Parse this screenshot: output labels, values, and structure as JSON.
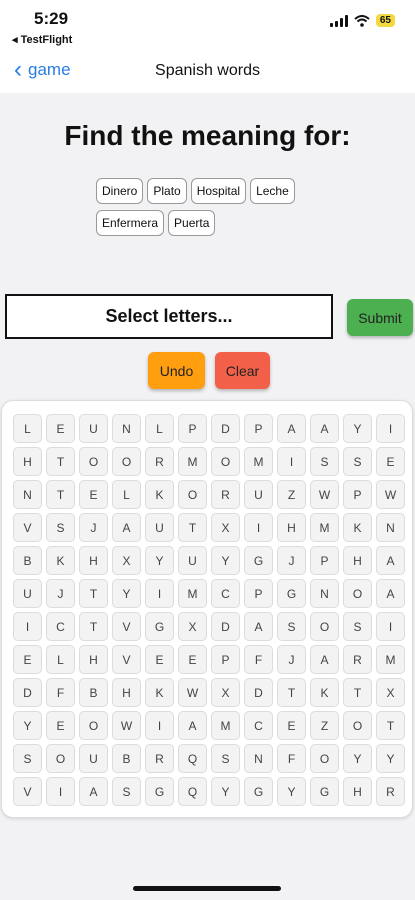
{
  "status": {
    "time": "5:29",
    "back_app": "◂ TestFlight",
    "battery": "65"
  },
  "nav": {
    "back_label": "game",
    "title": "Spanish words"
  },
  "heading": "Find the meaning for:",
  "words": [
    "Dinero",
    "Plato",
    "Hospital",
    "Leche",
    "Enfermera",
    "Puerta"
  ],
  "selection": {
    "placeholder": "Select letters..."
  },
  "buttons": {
    "submit": "Submit",
    "undo": "Undo",
    "clear": "Clear"
  },
  "colors": {
    "submit": "#4caf50",
    "undo": "#ff9f10",
    "clear": "#f26049",
    "link": "#2a7de1"
  },
  "grid": [
    [
      "L",
      "E",
      "U",
      "N",
      "L",
      "P",
      "D",
      "P",
      "A",
      "A",
      "Y",
      "I"
    ],
    [
      "H",
      "T",
      "O",
      "O",
      "R",
      "M",
      "O",
      "M",
      "I",
      "S",
      "S",
      "E"
    ],
    [
      "N",
      "T",
      "E",
      "L",
      "K",
      "O",
      "R",
      "U",
      "Z",
      "W",
      "P",
      "W"
    ],
    [
      "V",
      "S",
      "J",
      "A",
      "U",
      "T",
      "X",
      "I",
      "H",
      "M",
      "K",
      "N"
    ],
    [
      "B",
      "K",
      "H",
      "X",
      "Y",
      "U",
      "Y",
      "G",
      "J",
      "P",
      "H",
      "A"
    ],
    [
      "U",
      "J",
      "T",
      "Y",
      "I",
      "M",
      "C",
      "P",
      "G",
      "N",
      "O",
      "A"
    ],
    [
      "I",
      "C",
      "T",
      "V",
      "G",
      "X",
      "D",
      "A",
      "S",
      "O",
      "S",
      "I"
    ],
    [
      "E",
      "L",
      "H",
      "V",
      "E",
      "E",
      "P",
      "F",
      "J",
      "A",
      "R",
      "M"
    ],
    [
      "D",
      "F",
      "B",
      "H",
      "K",
      "W",
      "X",
      "D",
      "T",
      "K",
      "T",
      "X"
    ],
    [
      "Y",
      "E",
      "O",
      "W",
      "I",
      "A",
      "M",
      "C",
      "E",
      "Z",
      "O",
      "T"
    ],
    [
      "S",
      "O",
      "U",
      "B",
      "R",
      "Q",
      "S",
      "N",
      "F",
      "O",
      "Y",
      "Y"
    ],
    [
      "V",
      "I",
      "A",
      "S",
      "G",
      "Q",
      "Y",
      "G",
      "Y",
      "G",
      "H",
      "R"
    ]
  ]
}
